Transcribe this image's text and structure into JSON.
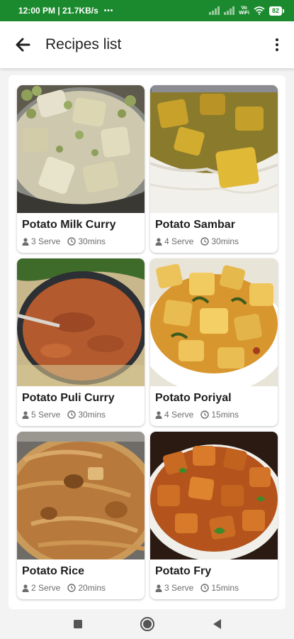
{
  "status_bar": {
    "time": "12:00 PM | 21.7KB/s",
    "dots": "•••",
    "volte": "Vo\nWiFi",
    "battery": "82"
  },
  "app_bar": {
    "title": "Recipes list",
    "back_icon": "arrow-left-icon",
    "menu_icon": "more-vertical-icon"
  },
  "recipes": [
    {
      "name": "Potato Milk Curry",
      "serve": "3 Serve",
      "time": "30mins"
    },
    {
      "name": "Potato Sambar",
      "serve": "4 Serve",
      "time": "30mins"
    },
    {
      "name": "Potato Puli Curry",
      "serve": "5 Serve",
      "time": "30mins"
    },
    {
      "name": "Potato Poriyal",
      "serve": "4 Serve",
      "time": "15mins"
    },
    {
      "name": "Potato Rice",
      "serve": "2 Serve",
      "time": "20mins"
    },
    {
      "name": "Potato Fry",
      "serve": "3 Serve",
      "time": "15mins"
    }
  ],
  "colors": {
    "status_bar": "#1b8a2e",
    "text_primary": "#1e1e1e",
    "text_secondary": "#6e6e6e"
  },
  "nav_bar": {
    "icons": [
      "recent-apps-icon",
      "home-icon",
      "back-icon"
    ]
  }
}
